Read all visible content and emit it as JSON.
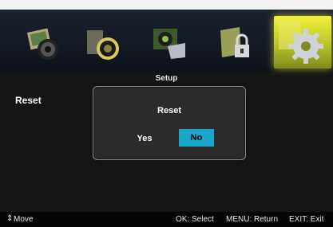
{
  "colors": {
    "selected_tab": "#dcdc32",
    "no_button_bg": "#1ba6c9",
    "background": "#141414"
  },
  "tabs": [
    {
      "icon": "picture-icon",
      "selected": false
    },
    {
      "icon": "audio-speaker-icon",
      "selected": false
    },
    {
      "icon": "screen-display-icon",
      "selected": false
    },
    {
      "icon": "lock-parental-icon",
      "selected": false
    },
    {
      "icon": "gear-setup-icon",
      "selected": true
    }
  ],
  "page": {
    "title": "Setup"
  },
  "menu": {
    "items": [
      {
        "label": "Reset"
      }
    ]
  },
  "dialog": {
    "title": "Reset",
    "yes_label": "Yes",
    "no_label": "No",
    "selected": "No"
  },
  "footer": {
    "move_icon": "up-down-arrow-icon",
    "move": "Move",
    "select": "OK: Select",
    "return": "MENU: Return",
    "exit": "EXIT: Exit"
  }
}
